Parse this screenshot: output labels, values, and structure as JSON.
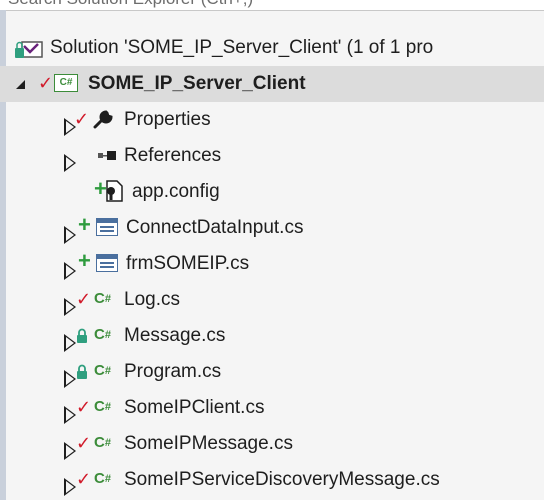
{
  "search": {
    "placeholder": "Search Solution Explorer (Ctrl+;)"
  },
  "solution": {
    "label": "Solution 'SOME_IP_Server_Client' (1 of 1 pro"
  },
  "project": {
    "label": "SOME_IP_Server_Client",
    "status": "✓",
    "icon_text": "C#"
  },
  "items": [
    {
      "label": "Properties",
      "status": "✓",
      "icon": "wrench-icon"
    },
    {
      "label": "References",
      "status": "",
      "icon": "references-icon"
    },
    {
      "label": "app.config",
      "status": "+",
      "icon": "config-file-icon"
    },
    {
      "label": "ConnectDataInput.cs",
      "status": "+",
      "icon": "form-icon"
    },
    {
      "label": "frmSOMEIP.cs",
      "status": "+",
      "icon": "form-icon"
    },
    {
      "label": "Log.cs",
      "status": "✓",
      "icon": "csharp-file-icon",
      "icon_text": "C#"
    },
    {
      "label": "Message.cs",
      "status": "🔒",
      "icon": "csharp-file-icon",
      "icon_text": "C#"
    },
    {
      "label": "Program.cs",
      "status": "🔒",
      "icon": "csharp-file-icon",
      "icon_text": "C#"
    },
    {
      "label": "SomeIPClient.cs",
      "status": "✓",
      "icon": "csharp-file-icon",
      "icon_text": "C#"
    },
    {
      "label": "SomeIPMessage.cs",
      "status": "✓",
      "icon": "csharp-file-icon",
      "icon_text": "C#"
    },
    {
      "label": "SomeIPServiceDiscoveryMessage.cs",
      "status": "✓",
      "icon": "csharp-file-icon",
      "icon_text": "C#"
    }
  ],
  "colors": {
    "check": "#d11a2a",
    "plus": "#2e9b3e",
    "lock": "#2f9f7f",
    "csharp": "#3c8c3a",
    "selected_row": "#dcdcdc"
  }
}
